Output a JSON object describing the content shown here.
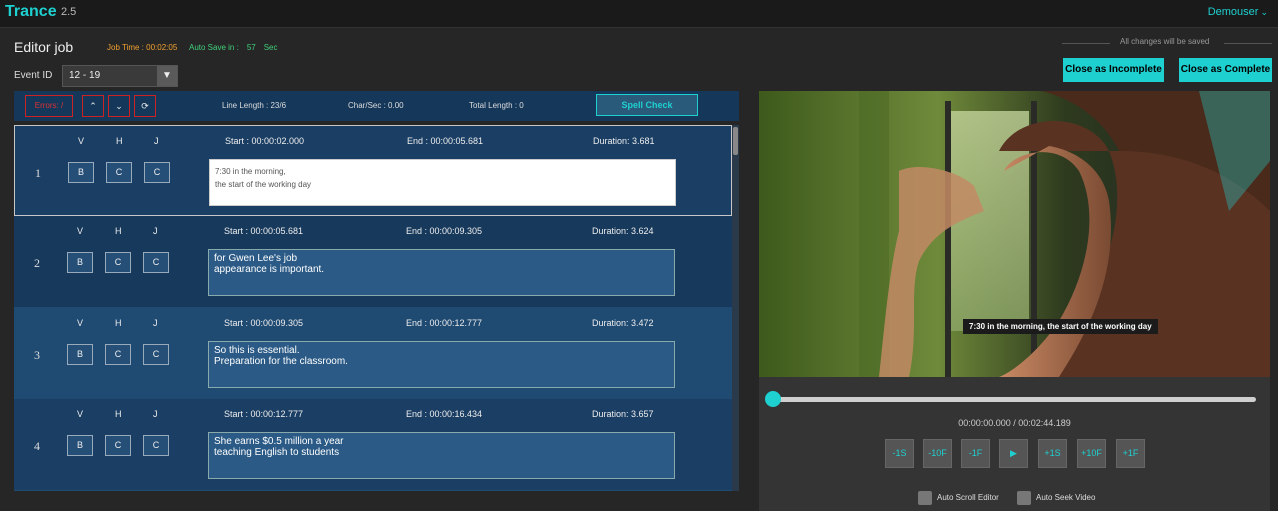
{
  "app": {
    "name": "Trance",
    "version": "2.5",
    "user": "Demouser"
  },
  "header": {
    "title": "Editor job",
    "job_time": "Job Time : 00:02:05",
    "auto_save_label": "Auto Save in :",
    "auto_save_value": "57",
    "auto_save_unit": "Sec",
    "save_status": "All changes will be saved",
    "close_incomplete": "Close as Incomplete",
    "close_complete": "Close as Complete"
  },
  "event": {
    "label": "Event ID",
    "selected": "12 - 19"
  },
  "toolbar": {
    "errors": "Errors: /",
    "line_length": "Line Length : 23/6",
    "char_sec": "Char/Sec : 0.00",
    "total_length": "Total Length : 0",
    "spell_check": "Spell Check"
  },
  "columns": {
    "v": "V",
    "h": "H",
    "j": "J",
    "btn_b": "B",
    "btn_c": "C"
  },
  "subtitles": [
    {
      "num": "1",
      "start": "Start : 00:00:02.000",
      "end": "End : 00:00:05.681",
      "duration": "Duration: 3.681",
      "text": "7:30 in the morning,\nthe start of the working day"
    },
    {
      "num": "2",
      "start": "Start : 00:00:05.681",
      "end": "End : 00:00:09.305",
      "duration": "Duration: 3.624",
      "text": "for Gwen Lee's job\nappearance is important."
    },
    {
      "num": "3",
      "start": "Start : 00:00:09.305",
      "end": "End : 00:00:12.777",
      "duration": "Duration: 3.472",
      "text": "So this is essential.\nPreparation for the classroom."
    },
    {
      "num": "4",
      "start": "Start : 00:00:12.777",
      "end": "End : 00:00:16.434",
      "duration": "Duration: 3.657",
      "text": "She earns $0.5 million a year\nteaching English to students"
    }
  ],
  "player": {
    "caption": "7:30 in the morning, the start of the working day",
    "timecode": "00:00:00.000 / 00:02:44.189",
    "progress": 0.0,
    "controls": [
      "-1S",
      "-10F",
      "-1F",
      "▶",
      "+1S",
      "+10F",
      "+1F"
    ],
    "auto_scroll": "Auto Scroll Editor",
    "auto_seek": "Auto Seek Video"
  }
}
